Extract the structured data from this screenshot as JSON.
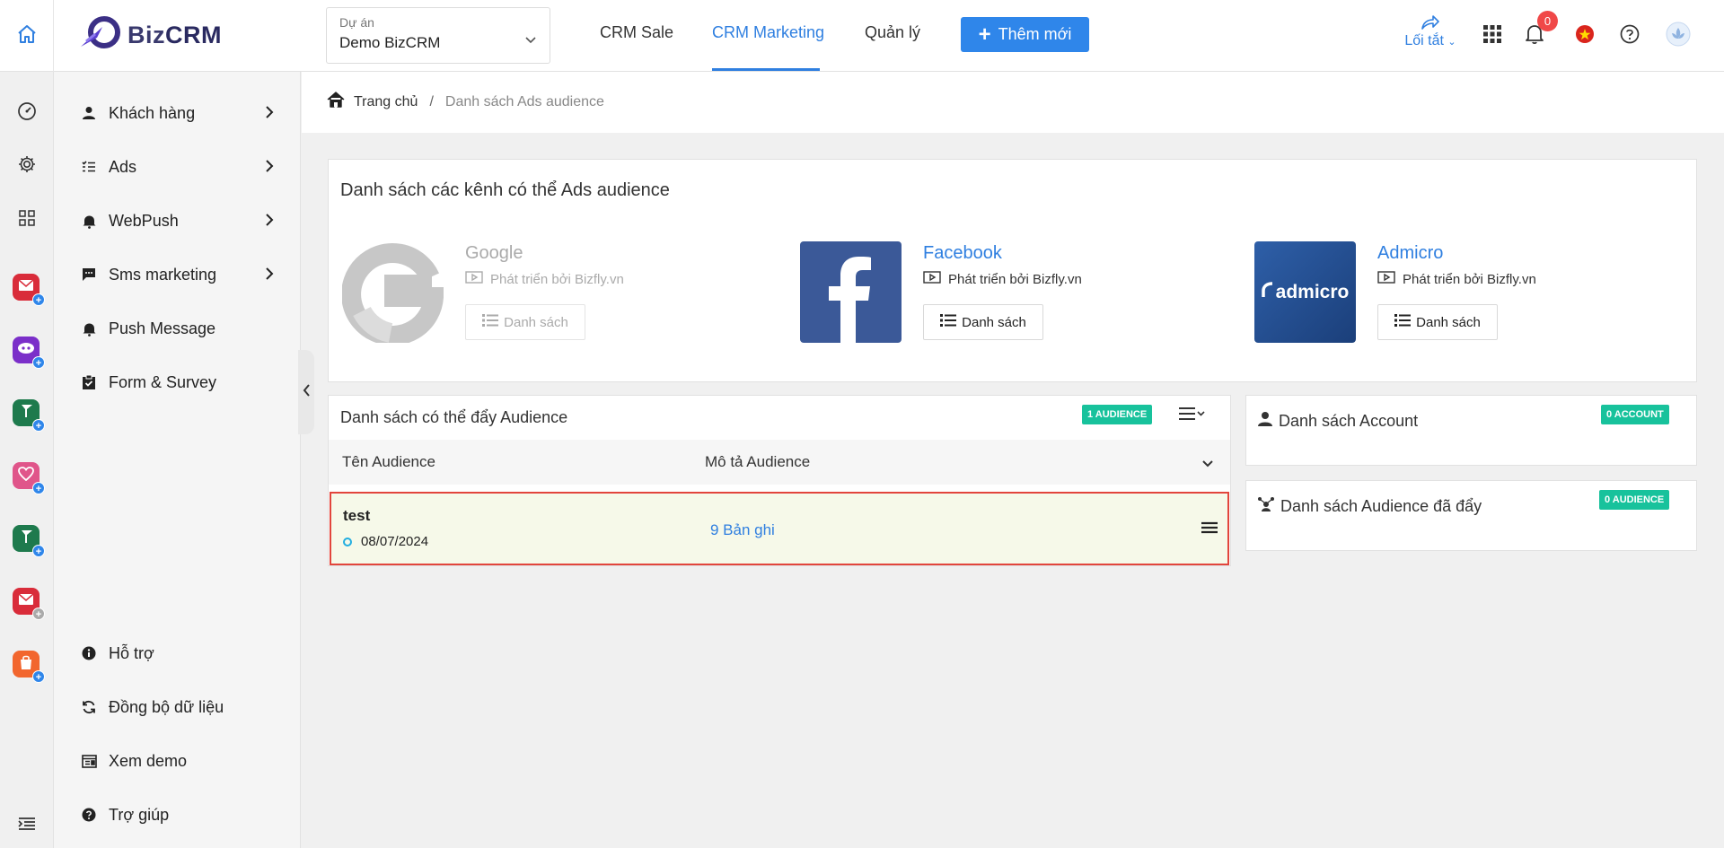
{
  "header": {
    "logo_text_a": "Biz",
    "logo_text_b": "CRM",
    "project_label": "Dự án",
    "project_value": "Demo BizCRM",
    "tabs": [
      {
        "label": "CRM Sale",
        "active": false
      },
      {
        "label": "CRM Marketing",
        "active": true
      },
      {
        "label": "Quản lý",
        "active": false
      }
    ],
    "add_button": "Thêm mới",
    "shortcut_label": "Lối tắt",
    "notification_count": "0",
    "accent_color": "#2f7fe0"
  },
  "rail": {
    "icons": [
      "dashboard-icon",
      "settings-icon",
      "apps-grid-icon"
    ],
    "apps": [
      {
        "name": "mail-app",
        "color": "#d92c3a"
      },
      {
        "name": "chat-app",
        "color": "#7b2fc9"
      },
      {
        "name": "flag-app",
        "color": "#1e7a4d"
      },
      {
        "name": "heart-app",
        "color": "#e0558a"
      },
      {
        "name": "flag-app-2",
        "color": "#1e7a4d"
      },
      {
        "name": "mail-app-2",
        "color": "#d92c3a"
      },
      {
        "name": "bag-app",
        "color": "#f2662e"
      }
    ]
  },
  "sidebar": {
    "items": [
      {
        "label": "Khách hàng",
        "icon": "user-icon",
        "has_arrow": true
      },
      {
        "label": "Ads",
        "icon": "list-check-icon",
        "has_arrow": true
      },
      {
        "label": "WebPush",
        "icon": "bell-ring-icon",
        "has_arrow": true
      },
      {
        "label": "Sms marketing",
        "icon": "message-icon",
        "has_arrow": true
      },
      {
        "label": "Push Message",
        "icon": "bell-ring-icon",
        "has_arrow": false
      },
      {
        "label": "Form & Survey",
        "icon": "clipboard-check-icon",
        "has_arrow": false
      }
    ],
    "bottom_items": [
      {
        "label": "Hỗ trợ",
        "icon": "info-icon"
      },
      {
        "label": "Đồng bộ dữ liệu",
        "icon": "sync-icon"
      },
      {
        "label": "Xem demo",
        "icon": "demo-window-icon"
      },
      {
        "label": "Trợ giúp",
        "icon": "help-icon"
      }
    ]
  },
  "breadcrumb": {
    "home": "Trang chủ",
    "separator": "/",
    "current": "Danh sách Ads audience"
  },
  "channels": {
    "title": "Danh sách các kênh có thể Ads audience",
    "items": [
      {
        "name": "Google",
        "developer": "Phát triển bởi Bizfly.vn",
        "button": "Danh sách",
        "enabled": false
      },
      {
        "name": "Facebook",
        "developer": "Phát triển bởi Bizfly.vn",
        "button": "Danh sách",
        "enabled": true
      },
      {
        "name": "Admicro",
        "developer": "Phát triển bởi Bizfly.vn",
        "button": "Danh sách",
        "enabled": true,
        "logo_text": "admicro"
      }
    ]
  },
  "audience_list": {
    "title": "Danh sách có thể đẩy Audience",
    "badge": "1 AUDIENCE",
    "columns": [
      "Tên Audience",
      "Mô tả Audience"
    ],
    "rows": [
      {
        "name": "test",
        "date": "08/07/2024",
        "description": "9 Bản ghi"
      }
    ]
  },
  "accounts": {
    "title": "Danh sách Account",
    "badge": "0 ACCOUNT"
  },
  "pushed_audience": {
    "title": "Danh sách Audience đã đẩy",
    "badge": "0 AUDIENCE"
  }
}
